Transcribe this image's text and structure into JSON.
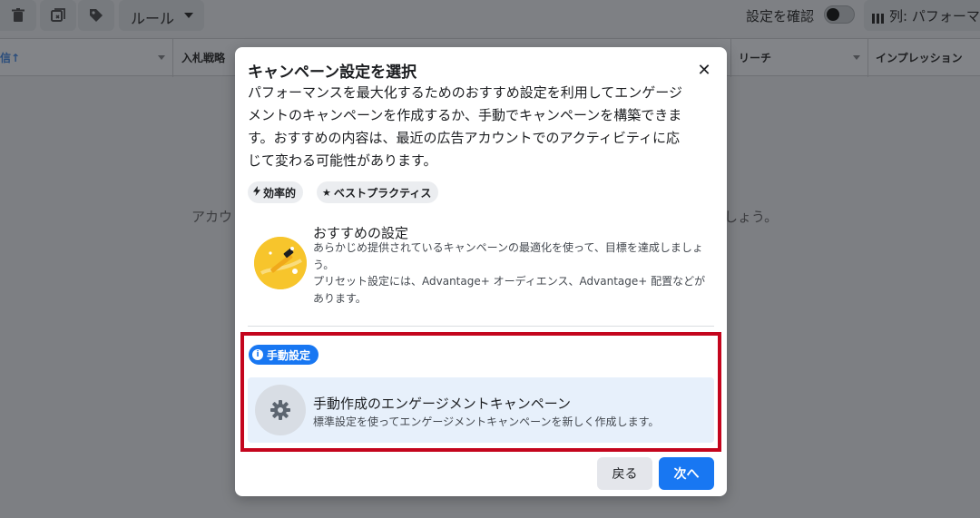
{
  "toolbar": {
    "rules_label": "ルール",
    "confirm_settings_label": "設定を確認",
    "columns_label": "列: パフォーマ"
  },
  "table": {
    "headers": [
      "信↑",
      "入札戦略",
      "リーチ",
      "インプレッション"
    ]
  },
  "background_message": {
    "left": "アカウ",
    "right": "しょう。"
  },
  "modal": {
    "title": "キャンペーン設定を選択",
    "description": "パフォーマンスを最大化するためのおすすめ設定を利用してエンゲージメントのキャンペーンを作成するか、手動でキャンペーンを構築できます。おすすめの内容は、最近の広告アカウントでのアクティビティに応じて変わる可能性があります。",
    "chips": [
      "効率的",
      "ベストプラクティス"
    ],
    "recommended": {
      "title": "おすすめの設定",
      "desc_line1": "あらかじめ提供されているキャンペーンの最適化を使って、目標を達成しましょう。",
      "desc_line2": "プリセット設定には、Advantage+ オーディエンス、Advantage+ 配置などがあります。"
    },
    "manual_badge": "手動設定",
    "manual_option": {
      "title": "手動作成のエンゲージメントキャンペーン",
      "desc": "標準設定を使ってエンゲージメントキャンペーンを新しく作成します。"
    },
    "back_label": "戻る",
    "next_label": "次へ"
  },
  "colors": {
    "accent": "#1877f2",
    "highlight": "#c4051d",
    "overlay": "#7d7f83"
  },
  "icons": [
    "trash-icon",
    "duplicate-icon",
    "tag-icon",
    "caret-down-icon",
    "columns-icon",
    "close-icon",
    "bolt-icon",
    "star-icon",
    "magic-wand-icon",
    "info-icon",
    "gear-icon"
  ]
}
